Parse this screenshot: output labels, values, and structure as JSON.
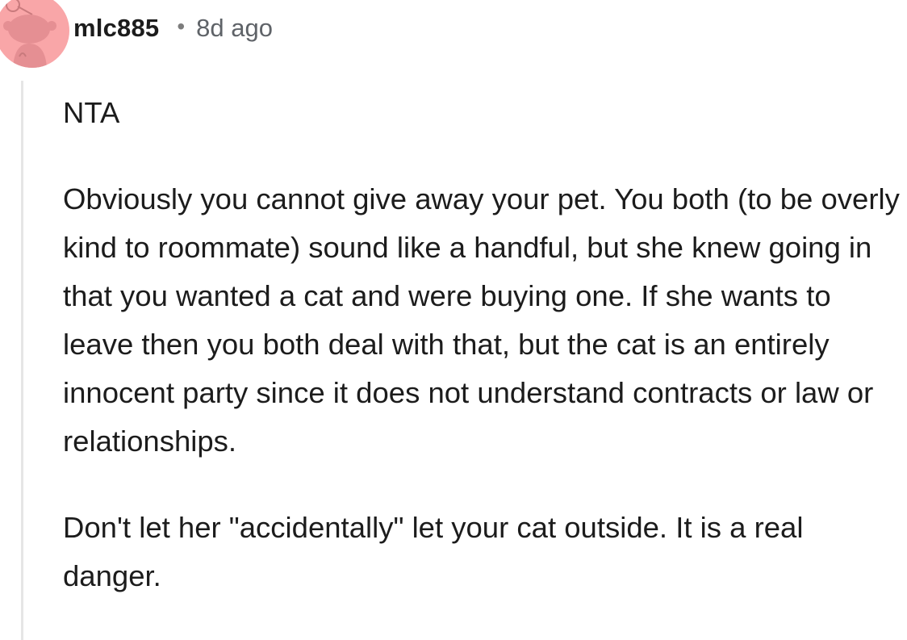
{
  "comment": {
    "author": "mlc885",
    "separator": "•",
    "time_ago": "8d ago",
    "avatar": {
      "icon": "reddit-snoo-avatar-icon",
      "color": "#f9a6a8"
    },
    "paragraphs": [
      "NTA",
      "Obviously you cannot give away your pet. You both (to be overly kind to roommate) sound like a handful, but she knew going in that you wanted a cat and were buying one. If she wants to leave then you both deal with that, but the cat is an entirely innocent party since it does not understand contracts or law or relationships.",
      "Don't let her \"accidentally\" let your cat outside. It is a real danger."
    ]
  }
}
